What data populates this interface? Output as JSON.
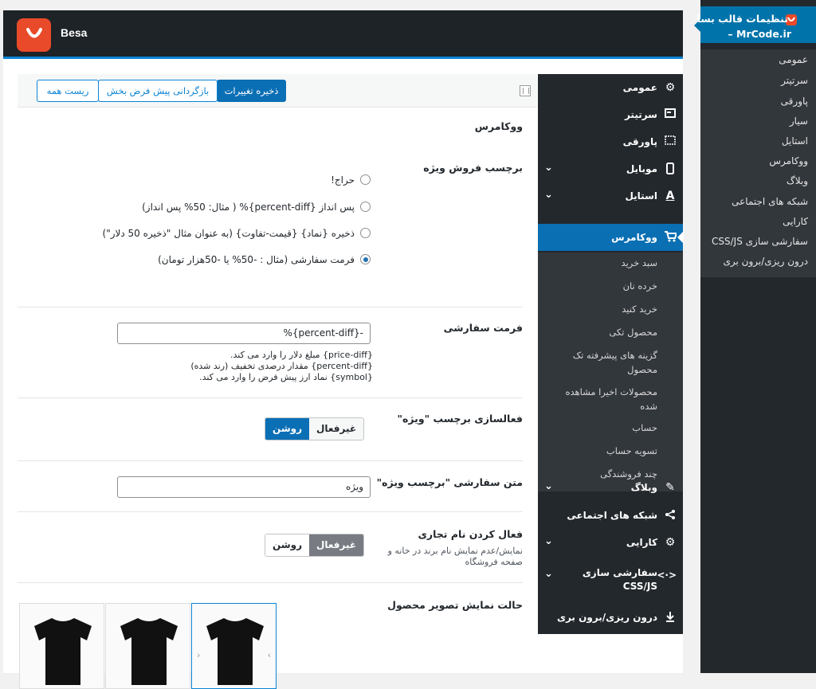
{
  "wp_admin": {
    "top_item_line1": "تنظیمات قالب بسا",
    "top_item_line2": "MrCode.ir –",
    "submenu": [
      "عمومی",
      "سرتیتر",
      "پاورقی",
      "سیار",
      "استایل",
      "ووکامرس",
      "وبلاگ",
      "شبکه های اجتماعی",
      "کارایی",
      "سفارشی سازی CSS/JS",
      "درون ریزی/برون بری"
    ]
  },
  "header": {
    "brand": "Besa"
  },
  "toolbar": {
    "save": "ذخیره تغییرات",
    "defaults": "بازگردانی پیش فرض بخش",
    "reset": "ریست همه"
  },
  "nav": {
    "general": "عمومی",
    "header": "سرتیتر",
    "footer": "پاورقی",
    "mobile": "موبایل",
    "style": "استایل",
    "woocommerce": "ووکامرس",
    "blog": "وبلاگ",
    "social": "شبکه های اجتماعی",
    "performance": "کارایی",
    "custom_css": "سفارشی سازی CSS/JS",
    "import_export": "درون ریزی/برون بری",
    "woo_sub": [
      "سبد خرید",
      "خرده نان",
      "خرید کنید",
      "محصول تکی",
      "گزینه های پیشرفته تک محصول",
      "محصولات اخیرا مشاهده شده",
      "حساب",
      "تسویه حساب",
      "چند فروشندگی"
    ]
  },
  "content": {
    "page_title": "ووکامرس",
    "sale_label": {
      "title": "برچسب فروش ویژه",
      "options": [
        "حراج!",
        "پس انداز {percent-diff}% ( مثال: 50% پس انداز)",
        "ذخیره {نماد} {قیمت-تفاوت} (به عنوان مثال \"ذخیره 50 دلار\")",
        "فرمت سفارشی (مثال : -50% یا -50هزار تومان)"
      ]
    },
    "custom_format": {
      "title": "فرمت سفارشی",
      "value": "-{percent-diff}%",
      "help": [
        "{price-diff} مبلغ دلار را وارد می کند.",
        "{percent-diff} مقدار درصدی تخفیف (رند شده)",
        "{symbol} نماد ارز پیش فرض را وارد می کند."
      ]
    },
    "activate_label": {
      "title": "فعالسازی برچسب \"ویژه\"",
      "off": "غیرفعال",
      "on": "روشن"
    },
    "custom_text": {
      "title": "متن سفارشی \"برچسب ویژه\"",
      "value": "ویژه"
    },
    "brand_name": {
      "title": "فعال کردن نام تجاری",
      "desc_line1": "نمایش/عدم نمایش نام برند در خانه و",
      "desc_line2": "صفحه فروشگاه",
      "off": "غیرفعال",
      "on": "روشن"
    },
    "image_mode": {
      "title": "حالت نمایش تصویر محصول"
    }
  },
  "colors": {
    "accent": "#0b6fb5",
    "brand": "#e84a2a",
    "dark": "#23282d"
  }
}
